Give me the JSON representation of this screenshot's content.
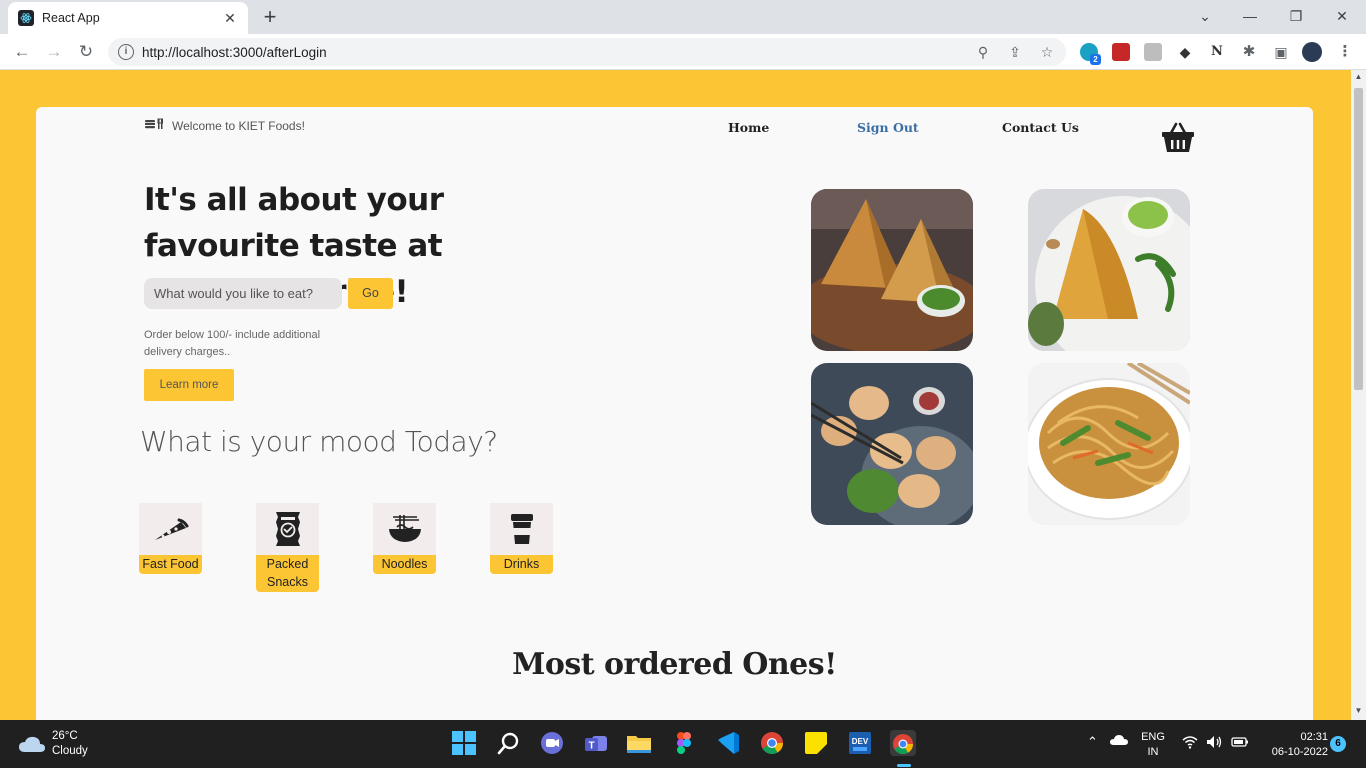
{
  "browser": {
    "tab_title": "React App",
    "url": "http://localhost:3000/afterLogin",
    "extension_badge": "2"
  },
  "page": {
    "brand": "Welcome to KIET Foods!",
    "nav": {
      "home": "Home",
      "sign_out": "Sign Out",
      "contact": "Contact Us"
    },
    "headline": "It's all about your favourite taste at favourite price!",
    "search_placeholder": "What would you like to eat?",
    "go_label": "Go",
    "note": "Order below 100/- include additional delivery charges..",
    "learn_more": "Learn more",
    "mood_heading": "What is your mood Today?",
    "categories": [
      {
        "label": "Fast Food",
        "icon": "pizza-slice-icon"
      },
      {
        "label": "Packed Snacks",
        "icon": "snack-packet-icon"
      },
      {
        "label": "Noodles",
        "icon": "noodle-bowl-icon"
      },
      {
        "label": "Drinks",
        "icon": "cup-icon"
      }
    ],
    "food_images": [
      "samosa-image",
      "dosa-image",
      "momos-image",
      "noodles-image"
    ],
    "section_heading": "Most ordered Ones!",
    "accent_color": "#fcc534"
  },
  "taskbar": {
    "temperature": "26°C",
    "weather": "Cloudy",
    "lang": "ENG",
    "region": "IN",
    "time": "02:31",
    "date": "06-10-2022",
    "notifications": "6"
  }
}
